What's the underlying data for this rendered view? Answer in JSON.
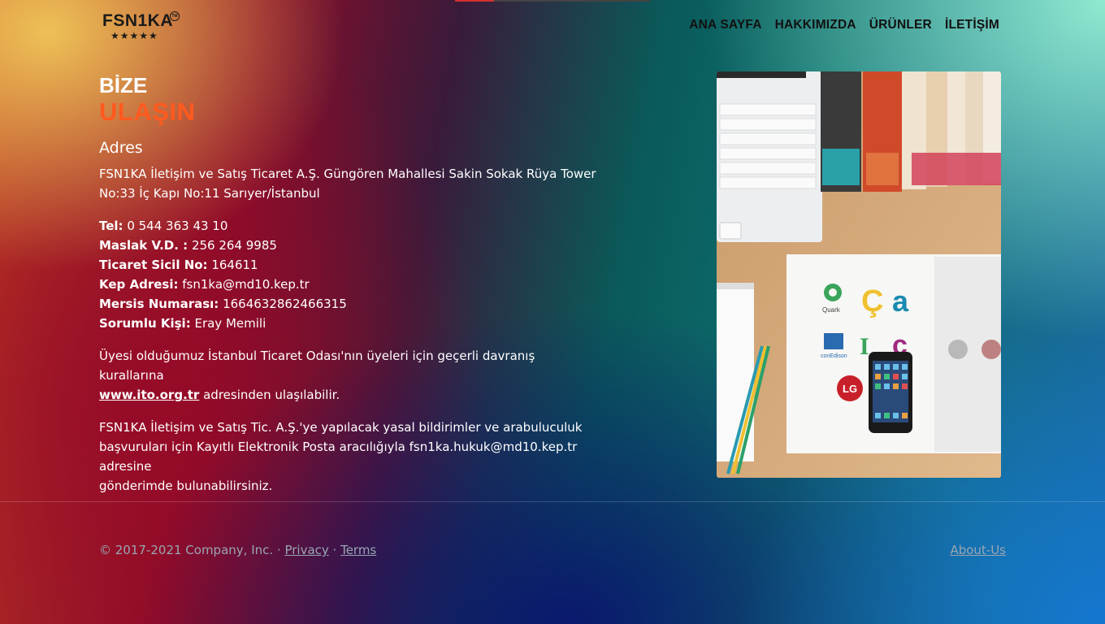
{
  "brand": {
    "logo_text": "FSN1KA",
    "stars": "★★★★★",
    "tm": "TM"
  },
  "nav": [
    {
      "label": "ANA SAYFA"
    },
    {
      "label": "HAKKIMIZDA"
    },
    {
      "label": "ÜRÜNLER"
    },
    {
      "label": "İLETİŞİM"
    }
  ],
  "contact": {
    "heading_line1": "BİZE",
    "heading_line2": "ULAŞIN",
    "address_title": "Adres",
    "address_line1": "FSN1KA İletişim ve Satış Ticaret A.Ş. Güngören Mahallesi Sakin Sokak Rüya Tower",
    "address_line2": "No:33 İç Kapı No:11 Sarıyer/İstanbul",
    "details": [
      {
        "label": "Tel:",
        "value": " 0 544 363 43 10"
      },
      {
        "label": "Maslak V.D. :",
        "value": " 256 264 9985"
      },
      {
        "label": "Ticaret Sicil No:",
        "value": " 164611"
      },
      {
        "label": "Kep Adresi:",
        "value": " fsn1ka@md10.kep.tr"
      },
      {
        "label": "Mersis Numarası:",
        "value": " 1664632862466315"
      },
      {
        "label": "Sorumlu Kişi:",
        "value": " Eray Memili"
      }
    ],
    "ito_text_before": "Üyesi olduğumuz İstanbul Ticaret Odası'nın üyeleri için geçerli davranış kurallarına",
    "ito_link": "www.ito.org.tr",
    "ito_text_after": " adresinden ulaşılabilir.",
    "legal_line1": "FSN1KA İletişim ve Satış Tic. A.Ş.'ye yapılacak yasal bildirimler ve arabuluculuk",
    "legal_line2": "başvuruları için Kayıtlı Elektronik Posta aracılığıyla fsn1ka.hukuk@md10.kep.tr adresine",
    "legal_line3": "gönderimde bulunabilirsiniz."
  },
  "photo": {
    "logos": [
      "Quark",
      "conEdison",
      "LG"
    ]
  },
  "footer": {
    "copyright": "© 2017-2021 Company, Inc. · ",
    "privacy": "Privacy",
    "sep": " · ",
    "terms": "Terms",
    "about": "About-Us"
  },
  "colors": {
    "accent": "#ff5a1f"
  }
}
